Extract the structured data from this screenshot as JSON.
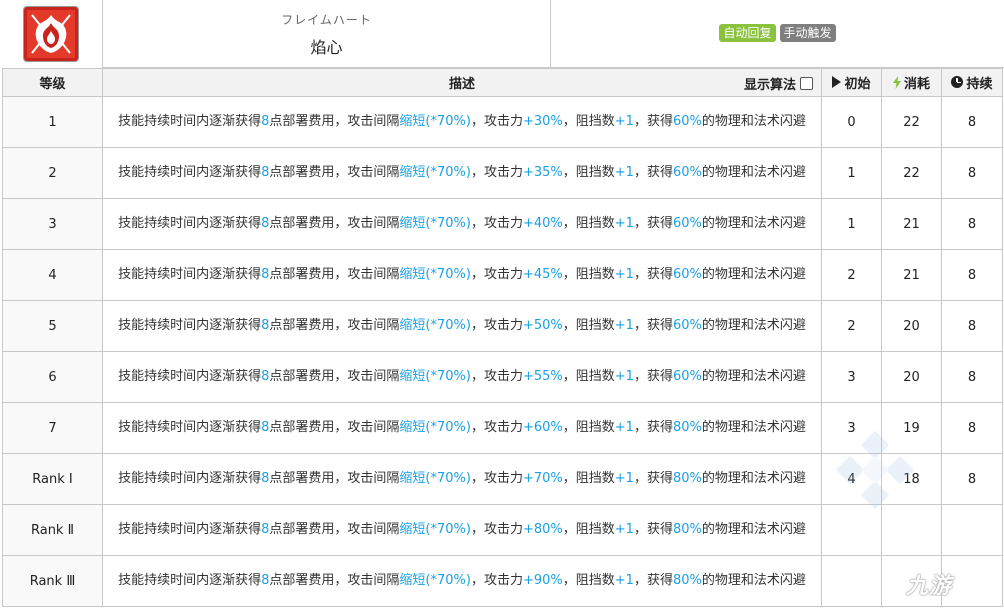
{
  "skill": {
    "name_jp": "フレイムハート",
    "name_cn": "焰心",
    "tags": [
      {
        "label": "自动回复",
        "color": "#8ac23d"
      },
      {
        "label": "手动触发",
        "color": "#7f7f7f"
      }
    ],
    "icon": "flame-heart-skill-icon"
  },
  "table": {
    "headers": {
      "level": "等级",
      "desc": "描述",
      "show_formula": "显示算法",
      "initial": "初始",
      "cost": "消耗",
      "duration": "持续"
    },
    "rows": [
      {
        "level": "1",
        "atk": "+30%",
        "res": "60%",
        "initial": "0",
        "cost": "22",
        "duration": "8"
      },
      {
        "level": "2",
        "atk": "+35%",
        "res": "60%",
        "initial": "1",
        "cost": "22",
        "duration": "8"
      },
      {
        "level": "3",
        "atk": "+40%",
        "res": "60%",
        "initial": "1",
        "cost": "21",
        "duration": "8"
      },
      {
        "level": "4",
        "atk": "+45%",
        "res": "60%",
        "initial": "2",
        "cost": "21",
        "duration": "8"
      },
      {
        "level": "5",
        "atk": "+50%",
        "res": "60%",
        "initial": "2",
        "cost": "20",
        "duration": "8"
      },
      {
        "level": "6",
        "atk": "+55%",
        "res": "60%",
        "initial": "3",
        "cost": "20",
        "duration": "8"
      },
      {
        "level": "7",
        "atk": "+60%",
        "res": "80%",
        "initial": "3",
        "cost": "19",
        "duration": "8"
      },
      {
        "level": "Rank Ⅰ",
        "atk": "+70%",
        "res": "80%",
        "initial": "4",
        "cost": "18",
        "duration": "8"
      },
      {
        "level": "Rank Ⅱ",
        "atk": "+80%",
        "res": "80%",
        "initial": "",
        "cost": "",
        "duration": ""
      },
      {
        "level": "Rank Ⅲ",
        "atk": "+90%",
        "res": "80%",
        "initial": "",
        "cost": "",
        "duration": ""
      }
    ],
    "desc_parts": {
      "p1": "技能持续时间内逐渐获得",
      "dp": "8",
      "p2": "点部署费用，攻击间隔",
      "shorten": "缩短(*70%)",
      "p3": "，攻击力",
      "p4": "，阻挡数",
      "block": "+1",
      "p5": "，获得",
      "p6": "的物理和法术闪避"
    },
    "highlight_color": "#1aa0e6"
  },
  "watermark": {
    "text": "九游"
  }
}
